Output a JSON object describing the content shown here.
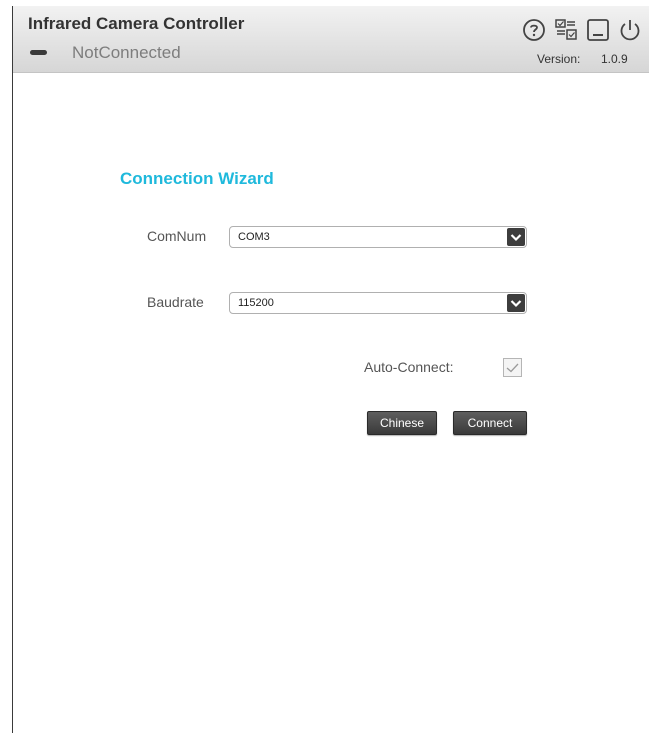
{
  "app": {
    "title": "Infrared Camera Controller",
    "status": "NotConnected",
    "version_label": "Version:",
    "version": "1.0.9"
  },
  "title_icons": [
    "help-icon",
    "settings-icon",
    "minimize-icon",
    "power-icon"
  ],
  "wizard": {
    "title": "Connection Wizard",
    "comnum": {
      "label": "ComNum",
      "value": "COM3"
    },
    "baudrate": {
      "label": "Baudrate",
      "value": "115200"
    },
    "auto_connect": {
      "label": "Auto-Connect:",
      "checked": true
    },
    "chinese_button": "Chinese",
    "connect_button": "Connect"
  },
  "colors": {
    "accent": "#1fb9dc",
    "button_bg": "#444444",
    "titlebar_bg": "#dcdcdc"
  }
}
